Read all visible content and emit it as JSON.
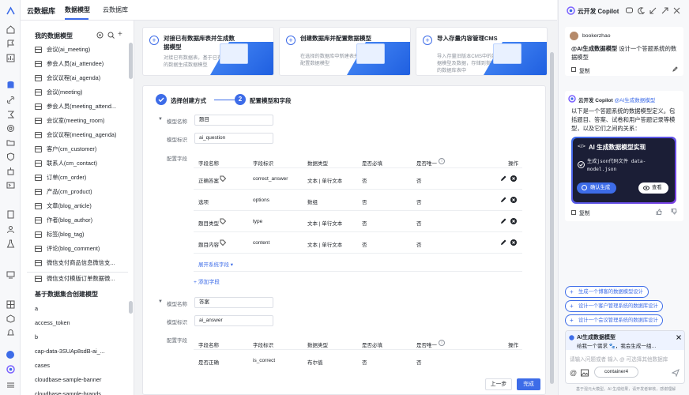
{
  "app": {
    "brand": "云数据库",
    "tabs": [
      "数据模型",
      "云数据库"
    ]
  },
  "sidebar": {
    "title": "我的数据模型",
    "models": [
      "会议(ai_meeting)",
      "参会人员(ai_attendee)",
      "会议议程(ai_agenda)",
      "会议(meeting)",
      "参会人员(meeting_attend...",
      "会议室(meeting_room)",
      "会议议程(meeting_agenda)",
      "客户(cm_customer)",
      "联系人(cm_contact)",
      "订单(cm_order)",
      "产品(cm_product)",
      "文章(blog_article)",
      "作者(blog_author)",
      "标签(blog_tag)",
      "评论(blog_comment)",
      "微信支付商品信息微信支...",
      "微信支付模版订单数据微..."
    ],
    "collections_title": "基于数据集合创建模型",
    "collections": [
      "a",
      "access_token",
      "b",
      "cap-data-3SUAp8sdB-ai_...",
      "cases",
      "cloudbase-sample-banner",
      "cloudbase-sample-brands"
    ]
  },
  "cards": [
    {
      "title": "对接已有数据库表并生成数据模型",
      "desc": "对接已有数据表，基于已有的数据生成数据模型"
    },
    {
      "title": "创建数据库并配置数据模型",
      "desc": "在选择的数据库中新建表并配置数据模型"
    },
    {
      "title": "导入存量内容管理CMS",
      "desc": "导入存量旧版本CMS中的数据模型及数据，存储到指定的数据库表中"
    }
  ],
  "steps": {
    "s1": "选择创建方式",
    "s2num": "2",
    "s2": "配置模型和字段"
  },
  "form": {
    "model_name": "模型名称",
    "model_id": "模型标识",
    "config": "配置字段",
    "expand": "展开系统字段",
    "add_field": "+ 添加字段",
    "prev": "上一步",
    "done": "完成"
  },
  "columns": [
    "字段名称",
    "字段标识",
    "数据类型",
    "是否必填",
    "是否唯一",
    "操作"
  ],
  "model1": {
    "name": "题目",
    "id": "ai_question",
    "rows": [
      {
        "name": "正确答案",
        "key": "correct_answer",
        "type": "文本 | 单行文本",
        "req": "否",
        "uniq": "否"
      },
      {
        "name": "选项",
        "key": "options",
        "type": "数组",
        "req": "否",
        "uniq": "否"
      },
      {
        "name": "题目类型",
        "key": "type",
        "type": "文本 | 单行文本",
        "req": "否",
        "uniq": "否"
      },
      {
        "name": "题目内容",
        "key": "content",
        "type": "文本 | 单行文本",
        "req": "否",
        "uniq": "否"
      }
    ]
  },
  "model2": {
    "name": "答案",
    "id": "ai_answer",
    "rows": [
      {
        "name": "是否正确",
        "key": "is_correct",
        "type": "布尔值",
        "req": "否",
        "uniq": "否"
      }
    ]
  },
  "copilot": {
    "title": "云开发 Copilot",
    "user": "bookerzhao",
    "user_msg_tag": "@AI生成数据模型",
    "user_msg": "设计一个答题系统的数据模型",
    "copy": "复制",
    "bot_name": "云开发 Copilot",
    "bot_tag": "@AI生成数据模型",
    "bot_msg": "以下是一个答题系统的数据模型定义。包括题目、答案、试卷和用户答题记录等模型，以及它们之间的关系：",
    "box_title": "AI 生成数据模型实现",
    "box_line": "生成json代码文件 data-model.json",
    "confirm": "确认生成",
    "view": "查看",
    "suggestions": [
      "生成一个博客的数据模型设计",
      "设计一个客户管理系统的数据库设计",
      "设计一个会议管理系统的数据库设计"
    ],
    "tag_title": "AI生成数据模型",
    "tag_desc": "给我一个需求 🐾，我会生成一组…",
    "input_placeholder": "请输入问题或者 输入 @ 可选择其他数据库",
    "container": "container4",
    "footer": "基于混元大模型。AI 生成结果，请开发者审核，感谢理解"
  }
}
